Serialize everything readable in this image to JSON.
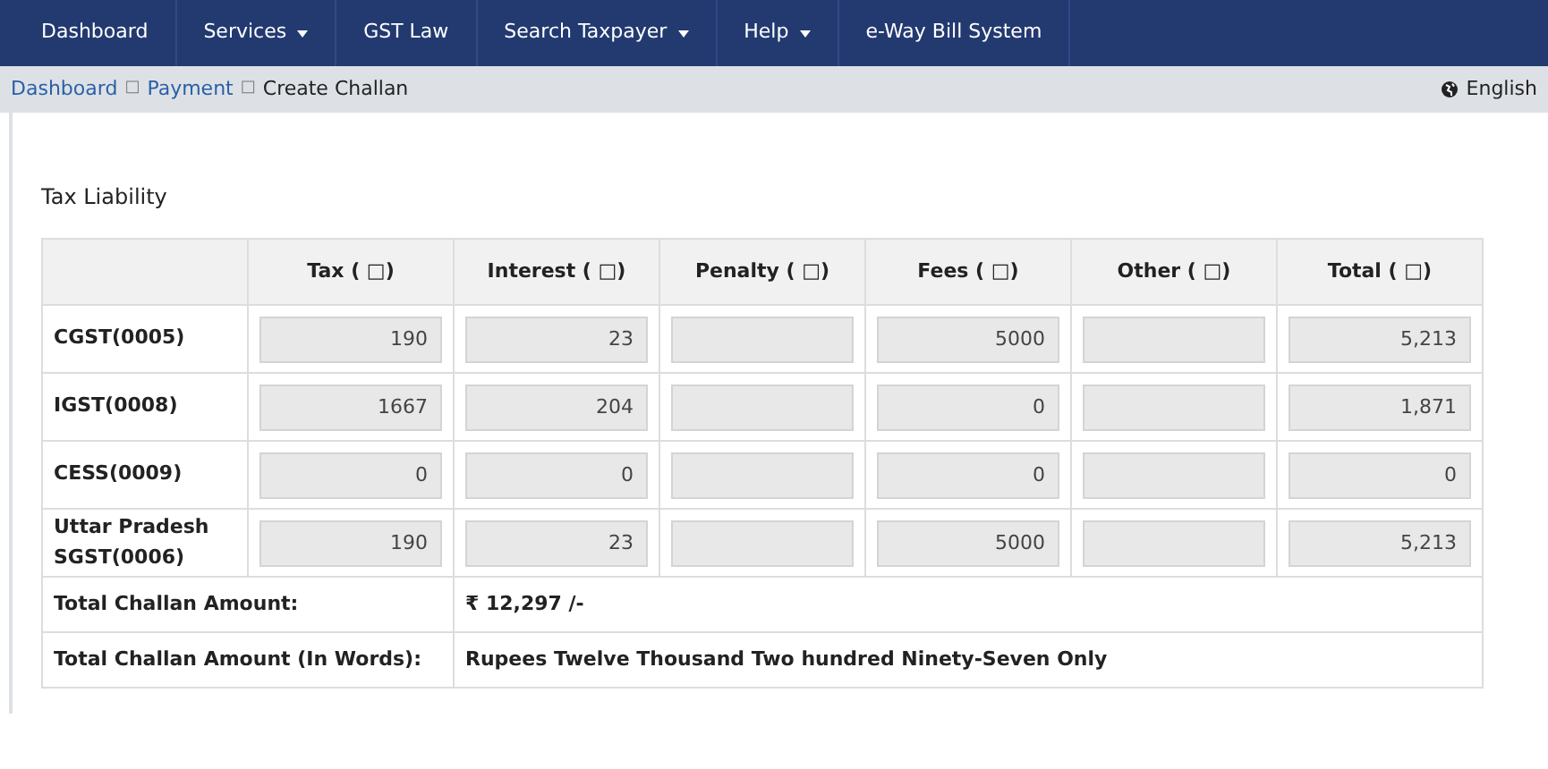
{
  "navbar": {
    "items": [
      {
        "label": "Dashboard",
        "dropdown": false
      },
      {
        "label": "Services",
        "dropdown": true
      },
      {
        "label": "GST Law",
        "dropdown": false
      },
      {
        "label": "Search Taxpayer",
        "dropdown": true
      },
      {
        "label": "Help",
        "dropdown": true
      },
      {
        "label": "e-Way Bill System",
        "dropdown": false
      }
    ]
  },
  "breadcrumb": {
    "items": [
      {
        "label": "Dashboard",
        "kind": "link"
      },
      {
        "label": "□",
        "kind": "separator"
      },
      {
        "label": "Payment",
        "kind": "link"
      },
      {
        "label": "□",
        "kind": "separator"
      },
      {
        "label": "Create Challan",
        "kind": "current"
      }
    ],
    "language": "English"
  },
  "section_title": "Tax Liability",
  "table": {
    "columns": [
      "Tax ( □)",
      "Interest ( □)",
      "Penalty ( □)",
      "Fees ( □)",
      "Other ( □)",
      "Total ( □)"
    ],
    "rows": [
      {
        "label": "CGST(0005)",
        "cells": [
          {
            "value": "190"
          },
          {
            "value": "23"
          },
          {},
          {
            "value": "5000"
          },
          {},
          {
            "value": "5,213"
          }
        ]
      },
      {
        "label": "IGST(0008)",
        "cells": [
          {
            "value": "1667"
          },
          {
            "value": "204"
          },
          {},
          {
            "value": "0"
          },
          {},
          {
            "value": "1,871"
          }
        ]
      },
      {
        "label": "CESS(0009)",
        "cells": [
          {
            "value": "0"
          },
          {
            "value": "0"
          },
          {},
          {
            "value": "0"
          },
          {},
          {
            "value": "0"
          }
        ]
      },
      {
        "label": "Uttar Pradesh SGST(0006)",
        "cells": [
          {
            "value": "190"
          },
          {
            "value": "23"
          },
          {},
          {
            "value": "5000"
          },
          {},
          {
            "value": "5,213"
          }
        ]
      }
    ],
    "totals": [
      {
        "label": "Total Challan Amount:",
        "value": "₹ 12,297 /-"
      },
      {
        "label": "Total Challan Amount (In Words):",
        "value": "Rupees Twelve Thousand Two hundred Ninety-Seven Only"
      }
    ]
  }
}
